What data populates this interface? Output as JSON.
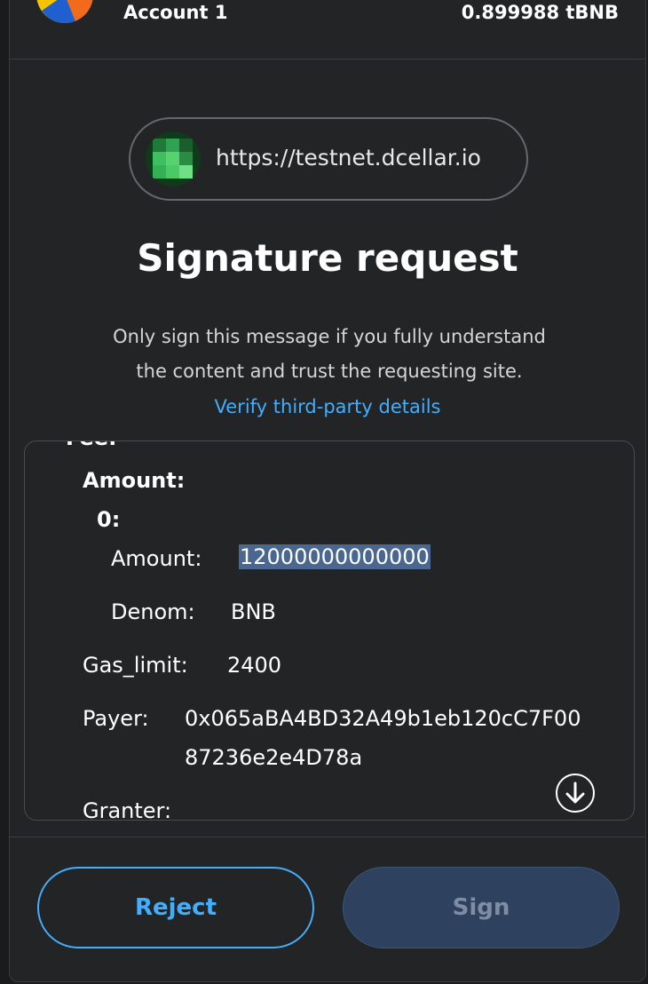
{
  "header": {
    "account_name": "Account 1",
    "balance": "0.899988 tBNB"
  },
  "origin": {
    "url": "https://testnet.dcellar.io",
    "icon": "dcellar-site-icon"
  },
  "title": "Signature request",
  "warning": {
    "line1": "Only sign this message if you fully understand",
    "line2": "the content and trust the requesting site."
  },
  "verify_link": "Verify third-party details",
  "message": {
    "fee_label": "Fee:",
    "amount_label": "Amount:",
    "index_label": "0:",
    "inner_amount_label": "Amount:",
    "inner_amount_value": "12000000000000",
    "denom_label": "Denom:",
    "denom_value": "BNB",
    "gas_limit_label": "Gas_limit:",
    "gas_limit_value": "2400",
    "payer_label": "Payer:",
    "payer_value_line1": "0x065aBA4BD32A49b1eb120cC7F00",
    "payer_value_line2": "87236e2e4D78a",
    "granter_label": "Granter:"
  },
  "buttons": {
    "reject": "Reject",
    "sign": "Sign"
  },
  "colors": {
    "background": "#232426",
    "link": "#43aefc",
    "highlight": "#49678f",
    "sign_disabled_bg": "#2e4260"
  }
}
